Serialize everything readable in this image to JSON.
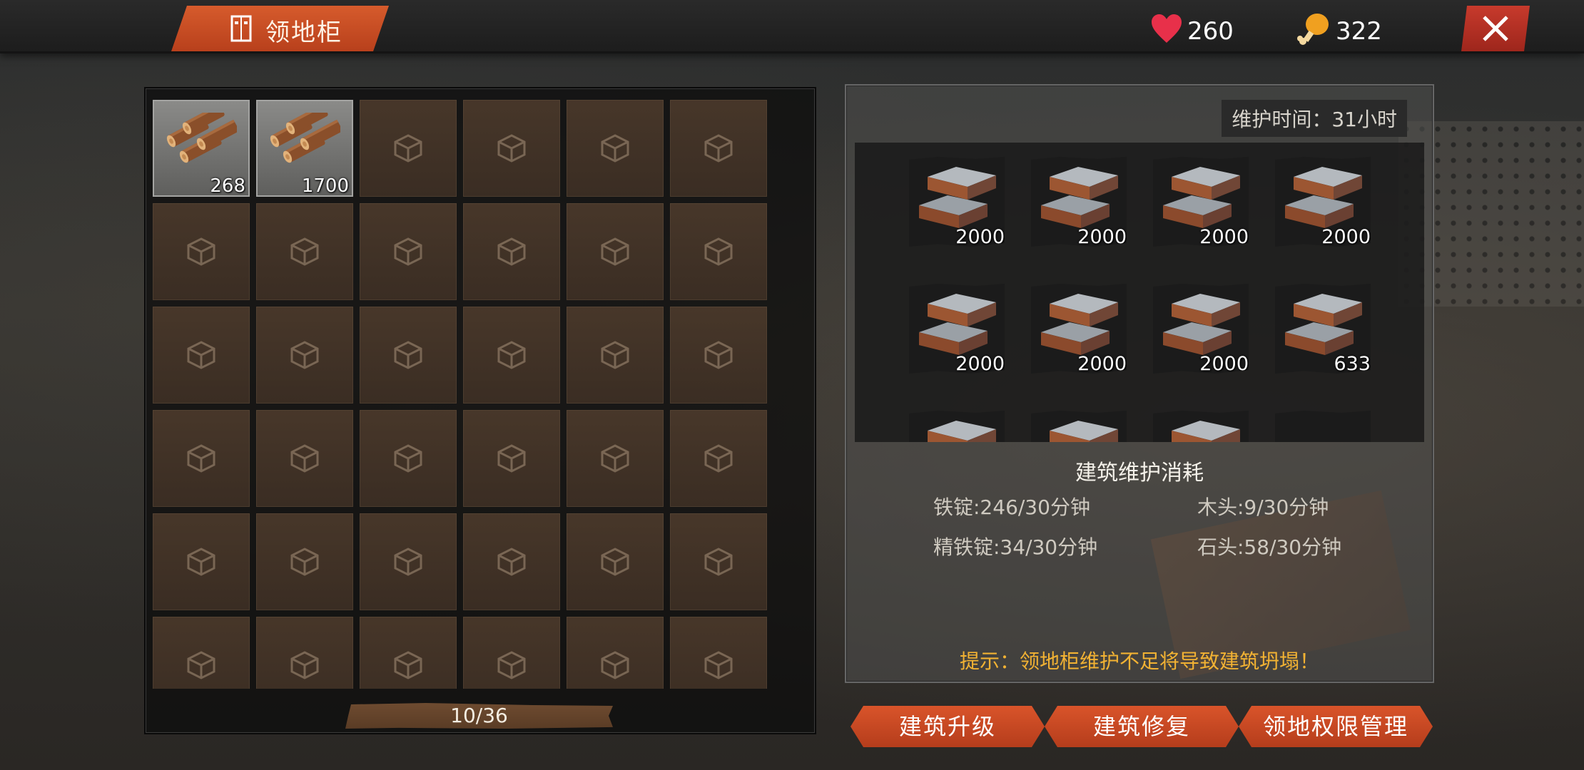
{
  "header": {
    "title": "领地柜",
    "health": "260",
    "food": "322",
    "title_icon": "cabinet-icon",
    "health_icon": "heart-icon",
    "food_icon": "drumstick-icon",
    "close_icon": "close-icon"
  },
  "inventory": {
    "slots": [
      {
        "item": "wood-logs-icon",
        "count": "268"
      },
      {
        "item": "wood-logs-icon",
        "count": "1700"
      }
    ],
    "capacity": "10/36"
  },
  "maintenance": {
    "time_label": "维护时间：31小时",
    "items": [
      {
        "item": "iron-ingot-icon",
        "count": "2000"
      },
      {
        "item": "iron-ingot-icon",
        "count": "2000"
      },
      {
        "item": "iron-ingot-icon",
        "count": "2000"
      },
      {
        "item": "iron-ingot-icon",
        "count": "2000"
      },
      {
        "item": "iron-ingot-icon",
        "count": "2000"
      },
      {
        "item": "iron-ingot-icon",
        "count": "2000"
      },
      {
        "item": "iron-ingot-icon",
        "count": "2000"
      },
      {
        "item": "iron-ingot-icon",
        "count": "633"
      }
    ],
    "consumption_title": "建筑维护消耗",
    "consumption": {
      "iron": "铁锭:246/30分钟",
      "wood": "木头:9/30分钟",
      "refined_iron": "精铁锭:34/30分钟",
      "stone": "石头:58/30分钟"
    },
    "hint": "提示：领地柜维护不足将导致建筑坍塌！"
  },
  "buttons": {
    "upgrade": "建筑升级",
    "repair": "建筑修复",
    "permissions": "领地权限管理"
  },
  "colors": {
    "accent": "#c9472a",
    "hint": "#f2b233",
    "heart": "#e8304a",
    "food": "#f0a020"
  }
}
